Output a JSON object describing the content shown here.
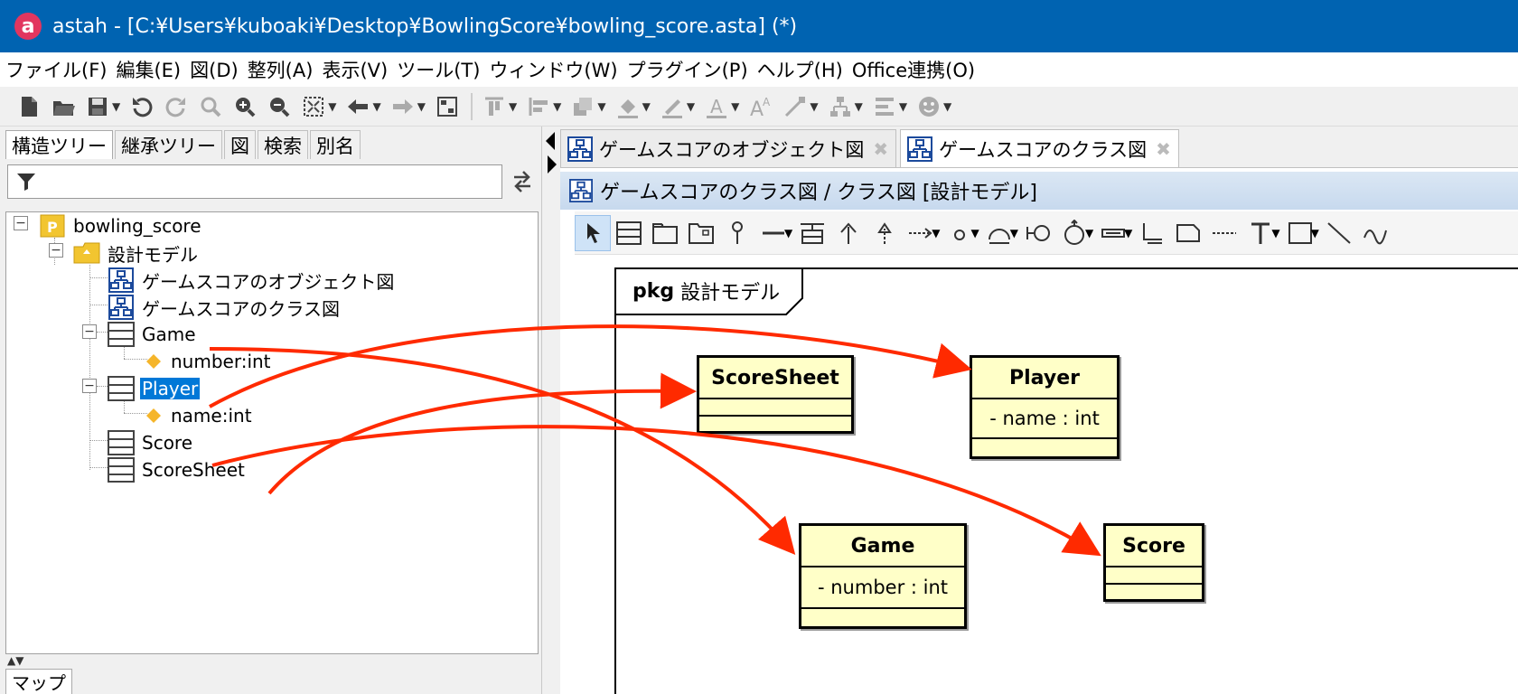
{
  "window": {
    "title": "astah - [C:¥Users¥kuboaki¥Desktop¥BowlingScore¥bowling_score.asta] (*)",
    "app_icon": "a"
  },
  "menubar": [
    "ファイル(F)",
    "編集(E)",
    "図(D)",
    "整列(A)",
    "表示(V)",
    "ツール(T)",
    "ウィンドウ(W)",
    "プラグイン(P)",
    "ヘルプ(H)",
    "Office連携(O)"
  ],
  "left_panel": {
    "tabs": [
      "構造ツリー",
      "継承ツリー",
      "図",
      "検索",
      "別名"
    ],
    "active_tab": "構造ツリー",
    "filter_value": "",
    "bottom_tab": "マップ",
    "tree": {
      "root": "bowling_score",
      "model": "設計モデル",
      "diagram1": "ゲームスコアのオブジェクト図",
      "diagram2": "ゲームスコアのクラス図",
      "class_game": "Game",
      "attr_game": "number:int",
      "class_player": "Player",
      "attr_player": "name:int",
      "class_score": "Score",
      "class_scoresheet": "ScoreSheet"
    }
  },
  "editor": {
    "tabs": [
      "ゲームスコアのオブジェクト図",
      "ゲームスコアのクラス図"
    ],
    "active_tab": "ゲームスコアのクラス図",
    "diagram_title": "ゲームスコアのクラス図 / クラス図 [設計モデル]",
    "package_label": "pkg",
    "package_name": "設計モデル",
    "classes": {
      "scoresheet": {
        "name": "ScoreSheet",
        "attr": ""
      },
      "player": {
        "name": "Player",
        "attr": "- name : int"
      },
      "game": {
        "name": "Game",
        "attr": "- number : int"
      },
      "score": {
        "name": "Score",
        "attr": ""
      }
    }
  },
  "colors": {
    "titlebar": "#0063b1",
    "class_fill": "#ffffc8",
    "selection": "#0078d7",
    "annotation_arrow": "#ff2a00"
  }
}
